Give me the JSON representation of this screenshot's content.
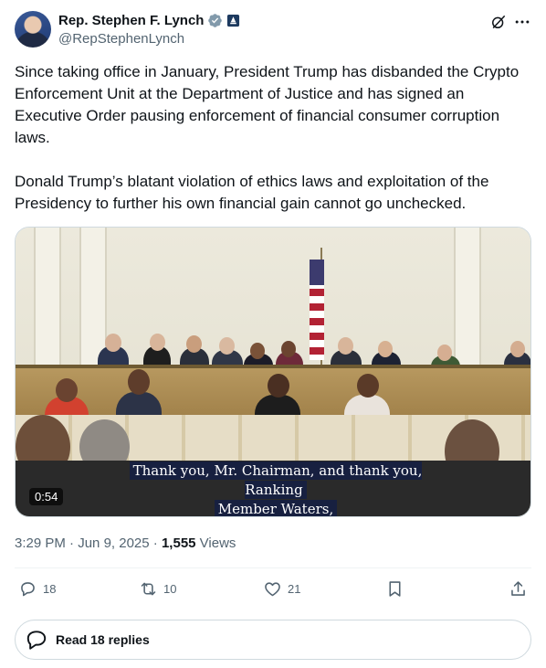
{
  "author": {
    "display_name": "Rep. Stephen F. Lynch",
    "handle": "@RepStephenLynch",
    "verified_icon": "verified-badge-icon",
    "affiliation_icon": "government-badge-icon"
  },
  "tweet": {
    "text": "Since taking office in January, President Trump has disbanded the Crypto Enforcement Unit at the Department of Justice and has signed an Executive Order pausing enforcement of financial consumer corruption laws.\n\nDonald Trump’s blatant violation of ethics laws and exploitation of the Presidency to further his own financial gain cannot go unchecked."
  },
  "video": {
    "caption_line1": "Thank you, Mr. Chairman, and thank you, Ranking",
    "caption_line2": "Member Waters,",
    "duration": "0:54"
  },
  "meta": {
    "time": "3:29 PM",
    "separator": " · ",
    "date": "Jun 9, 2025",
    "views_count": "1,555",
    "views_label": " Views"
  },
  "actions": {
    "replies": "18",
    "reposts": "10",
    "likes": "21"
  },
  "replies_button": {
    "label": "Read 18 replies"
  },
  "colors": {
    "text": "#0f1419",
    "secondary": "#536471",
    "border": "#cfd9de",
    "verified": "#829aab"
  }
}
